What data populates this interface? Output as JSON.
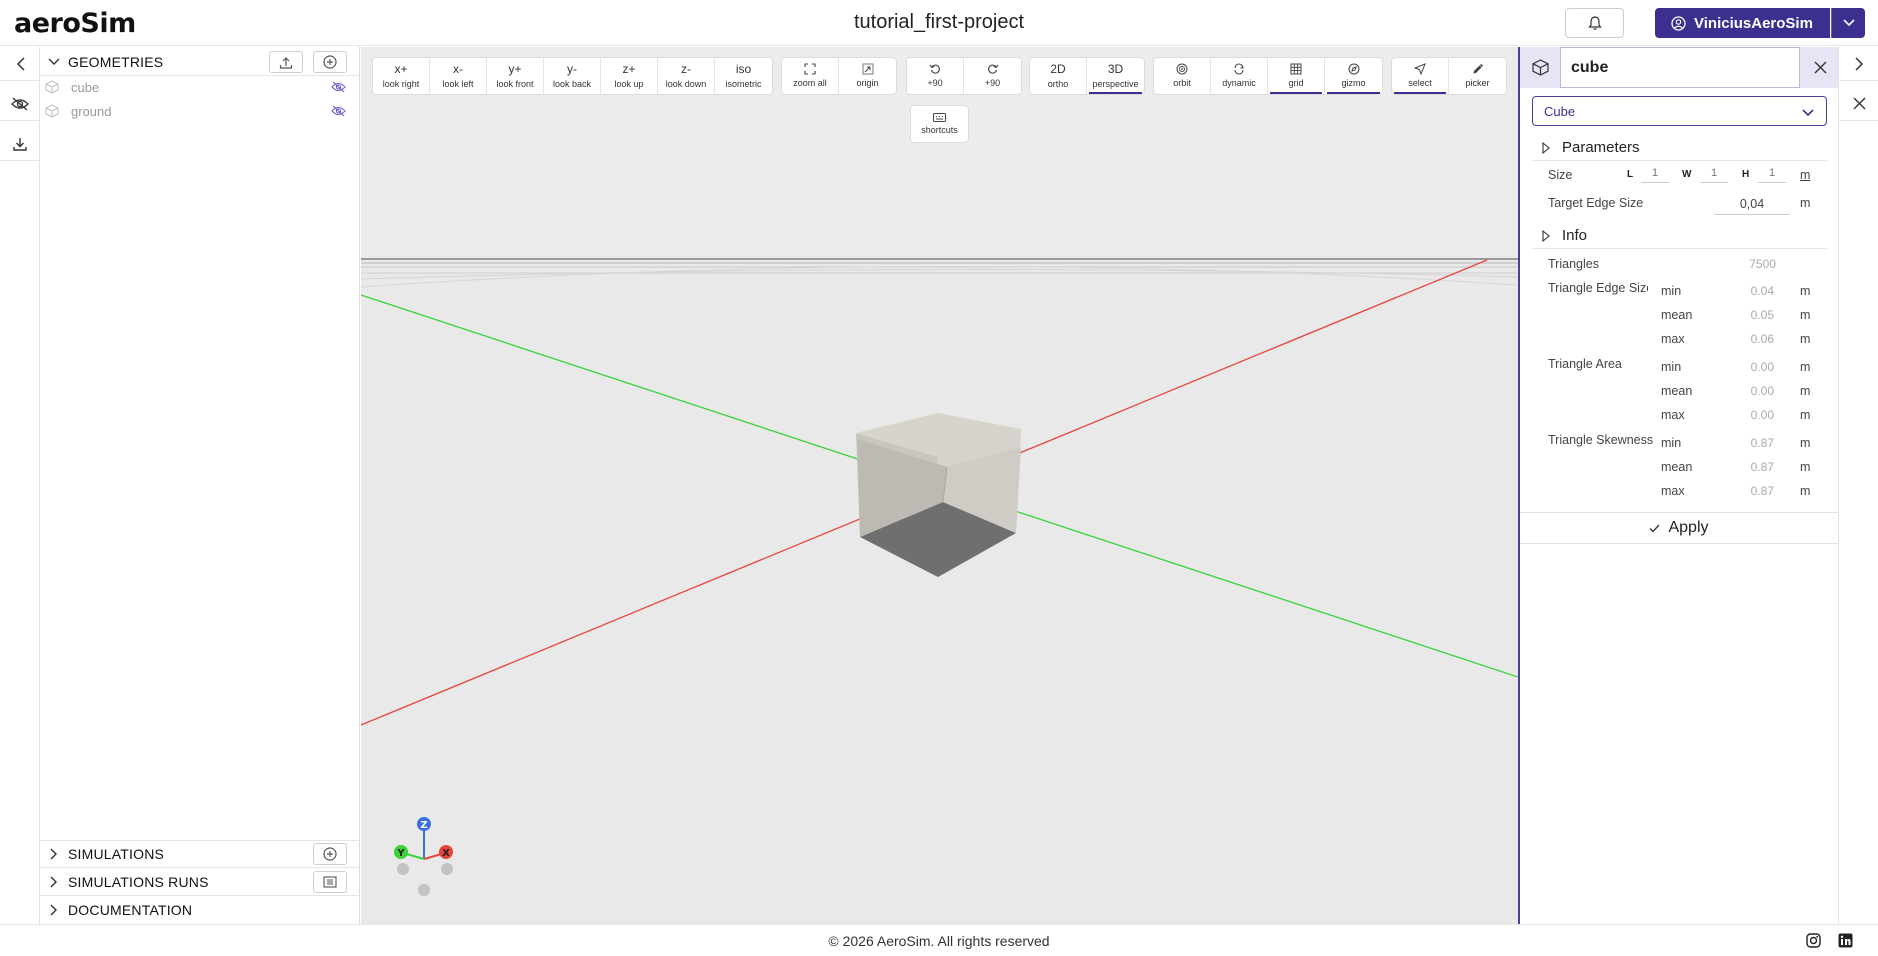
{
  "header": {
    "logo": "aeroSim",
    "project_title": "tutorial_first-project",
    "user_name": "ViniciusAeroSim"
  },
  "left_rail": {
    "items": [
      {
        "icon": "chevron-left-icon"
      },
      {
        "icon": "eye-off-icon"
      },
      {
        "icon": "download-icon"
      }
    ]
  },
  "sidebar": {
    "geometries": {
      "label": "GEOMETRIES",
      "items": [
        {
          "name": "cube"
        },
        {
          "name": "ground"
        }
      ]
    },
    "simulations_label": "SIMULATIONS",
    "simulation_runs_label": "SIMULATIONS RUNS",
    "documentation_label": "DOCUMENTATION"
  },
  "toolbar": {
    "view_group": [
      {
        "top": "x+",
        "bottom": "look right"
      },
      {
        "top": "x-",
        "bottom": "look left"
      },
      {
        "top": "y+",
        "bottom": "look front"
      },
      {
        "top": "y-",
        "bottom": "look back"
      },
      {
        "top": "z+",
        "bottom": "look up"
      },
      {
        "top": "z-",
        "bottom": "look down"
      },
      {
        "top": "iso",
        "bottom": "isometric"
      }
    ],
    "zoom_group": [
      {
        "icon": "zoom-all-icon",
        "bottom": "zoom all"
      },
      {
        "icon": "origin-icon",
        "bottom": "origin"
      }
    ],
    "rotate_group": [
      {
        "icon": "rotate-ccw-icon",
        "bottom": "+90"
      },
      {
        "icon": "rotate-cw-icon",
        "bottom": "+90"
      }
    ],
    "projection_group": [
      {
        "top": "2D",
        "bottom": "ortho",
        "active": false
      },
      {
        "top": "3D",
        "bottom": "perspective",
        "active": true
      }
    ],
    "mode_group": [
      {
        "icon": "orbit-icon",
        "bottom": "orbit",
        "active": false
      },
      {
        "icon": "dynamic-icon",
        "bottom": "dynamic",
        "active": false
      },
      {
        "icon": "grid-icon",
        "bottom": "grid",
        "active": true
      },
      {
        "icon": "gizmo-icon",
        "bottom": "gizmo",
        "active": true
      }
    ],
    "select_group": [
      {
        "icon": "select-icon",
        "bottom": "select",
        "active": true
      },
      {
        "icon": "picker-icon",
        "bottom": "picker",
        "active": false
      }
    ],
    "shortcuts": {
      "icon": "keyboard-icon",
      "bottom": "shortcuts"
    }
  },
  "gizmo": {
    "x_label": "X",
    "y_label": "Y",
    "z_label": "Z"
  },
  "right_panel": {
    "name_value": "cube",
    "type_select": "Cube",
    "parameters_label": "Parameters",
    "size_label": "Size",
    "size_dims": [
      {
        "label": "L",
        "value": "1"
      },
      {
        "label": "W",
        "value": "1"
      },
      {
        "label": "H",
        "value": "1"
      }
    ],
    "size_unit": "m",
    "target_edge_label": "Target Edge Size",
    "target_edge_value": "0,04",
    "target_edge_unit": "m",
    "info_label": "Info",
    "triangles_label": "Triangles",
    "triangles_value": "7500",
    "stat_groups": [
      {
        "label": "Triangle Edge Size",
        "rows": [
          {
            "stat": "min",
            "value": "0.04",
            "unit": "m"
          },
          {
            "stat": "mean",
            "value": "0.05",
            "unit": "m"
          },
          {
            "stat": "max",
            "value": "0.06",
            "unit": "m"
          }
        ]
      },
      {
        "label": "Triangle Area",
        "rows": [
          {
            "stat": "min",
            "value": "0.00",
            "unit": "m"
          },
          {
            "stat": "mean",
            "value": "0.00",
            "unit": "m"
          },
          {
            "stat": "max",
            "value": "0.00",
            "unit": "m"
          }
        ]
      },
      {
        "label": "Triangle Skewness",
        "rows": [
          {
            "stat": "min",
            "value": "0.87",
            "unit": "m"
          },
          {
            "stat": "mean",
            "value": "0.87",
            "unit": "m"
          },
          {
            "stat": "max",
            "value": "0.87",
            "unit": "m"
          }
        ]
      }
    ],
    "apply_label": "Apply"
  },
  "footer": {
    "copyright": "© 2026 AeroSim. All rights reserved"
  },
  "colors": {
    "accent": "#3b2f8f",
    "axis_x": "#e8463c",
    "axis_y": "#3ad33a",
    "axis_z": "#3b6fe0"
  }
}
